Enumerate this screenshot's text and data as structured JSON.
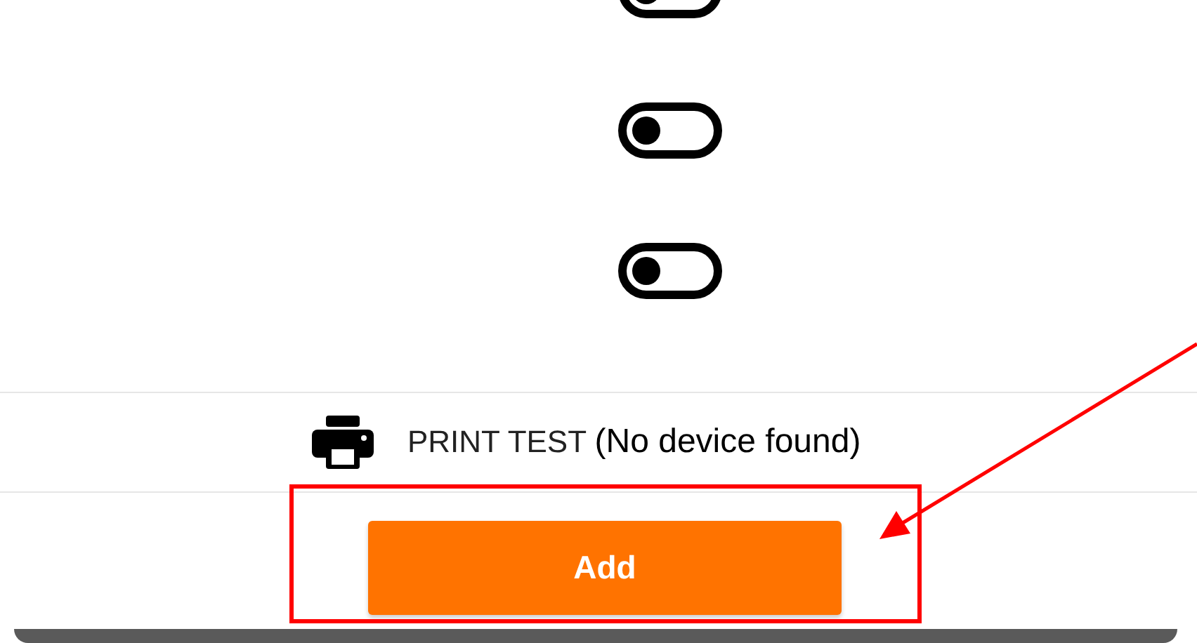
{
  "toggles": [
    {
      "on": false
    },
    {
      "on": false
    },
    {
      "on": false
    }
  ],
  "print_test": {
    "label": "PRINT TEST **(No device found)**"
  },
  "add_button": {
    "label": "Add"
  },
  "highlight_box": {
    "color": "#ff0000"
  },
  "arrow": {
    "color": "#ff0000"
  }
}
